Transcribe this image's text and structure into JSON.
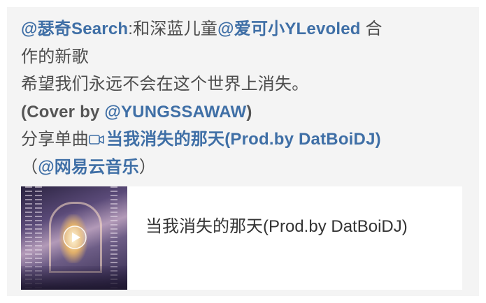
{
  "post": {
    "line1": {
      "mention1": "@瑟奇Search",
      "text1": ":和深蓝儿童",
      "mention2": "@爱可小YLevoled",
      "text2": " 合"
    },
    "line2": "作的新歌",
    "line3": "希望我们永远不会在这个世界上消失。",
    "line4": {
      "prefix": "(Cover by ",
      "mention": "@YUNGSSAWAW",
      "suffix": ")"
    },
    "line5": {
      "text": "分享单曲",
      "icon": "video-icon",
      "link": "当我消失的那天(Prod.by DatBoiDJ)"
    },
    "line6": {
      "open": "（",
      "mention": "@网易云音乐",
      "close": "）"
    }
  },
  "music_card": {
    "title": "当我消失的那天(Prod.by DatBoiDJ)",
    "cover_icon": "play-icon"
  },
  "colors": {
    "mention": "#3f6fa6",
    "text": "#4d4d4d",
    "card_bg": "#f4f4f4"
  }
}
